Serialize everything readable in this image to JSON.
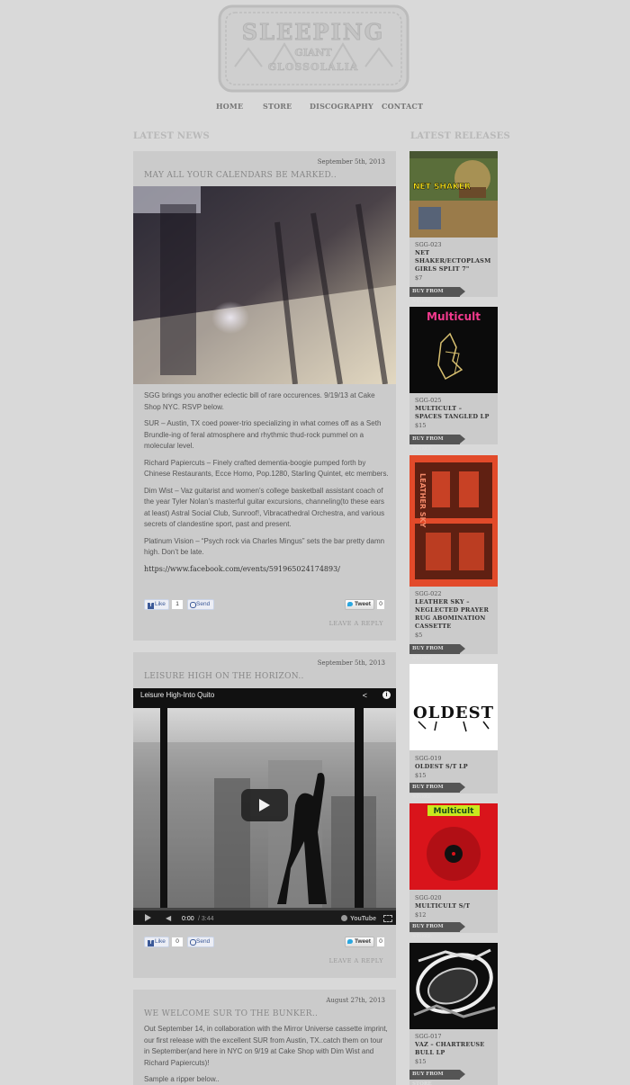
{
  "logo": {
    "line1": "SLEEPING",
    "line2": "GIANT",
    "line3": "GLOSSOLALIA"
  },
  "nav": [
    "HOME",
    "STORE",
    "DISCOGRAPHY",
    "CONTACT"
  ],
  "sections": {
    "news": "LATEST NEWS",
    "releases": "LATEST RELEASES"
  },
  "posts": [
    {
      "date": "September 5th, 2013",
      "title": "MAY ALL YOUR CALENDARS BE MARKED..",
      "paragraphs": [
        "SGG brings you another eclectic bill of rare occurences. 9/19/13 at Cake Shop NYC. RSVP below.",
        "SUR – Austin, TX coed power-trio specializing in what comes off as a Seth Brundle-ing of feral atmosphere and rhythmic thud-rock pummel on a molecular level.",
        "Richard Papiercuts – Finely crafted dementia-boogie pumped forth by Chinese Restaurants, Ecce Homo, Pop.1280, Starling Quintet, etc members.",
        "Dim Wist – Vaz guitarist and women’s college basketball assistant coach of the year Tyler Nolan’s masterful guitar excursions, channeling(to these ears at least) Astral Social Club, Sunroof!, Vibracathedral Orchestra, and various secrets of clandestine sport, past and present.",
        "Platinum Vision – “Psych rock via Charles Mingus” sets the bar pretty damn high. Don’t be late."
      ],
      "link": "https://www.facebook.com/events/591965024174893/",
      "like_label": "Like",
      "like_count": "1",
      "send_label": "Send",
      "tweet_label": "Tweet",
      "tweet_count": "0",
      "reply": "LEAVE A REPLY"
    },
    {
      "date": "September 5th, 2013",
      "title": "LEISURE HIGH ON THE HORIZON..",
      "video_title": "Leisure High-Into Quito",
      "video_time": "0:00",
      "video_duration": "/ 3:44",
      "youtube": "YouTube",
      "like_label": "Like",
      "like_count": "0",
      "send_label": "Send",
      "tweet_label": "Tweet",
      "tweet_count": "0",
      "reply": "LEAVE A REPLY"
    },
    {
      "date": "August 27th, 2013",
      "title": "WE WELCOME SUR TO THE BUNKER..",
      "paragraphs": [
        "Out September 14, in collaboration with the Mirror Universe cassette imprint, our first release with the excellent SUR from Austin, TX..catch them on tour in September(and here in NYC on 9/19 at Cake Shop with Dim Wist and Richard Papiercuts)!",
        "Sample a ripper below.."
      ]
    }
  ],
  "releases": [
    {
      "cat": "SGG-023",
      "title": "NET SHAKER/ECTOPLASM GIRLS SPLIT 7\"",
      "price": "$7",
      "buy": "BUY FROM STORE",
      "cover_text": "NET SHAKER"
    },
    {
      "cat": "SGG-025",
      "title": "MULTICULT – SPACES TANGLED LP",
      "price": "$15",
      "buy": "BUY FROM STORE",
      "cover_text": "Multicult"
    },
    {
      "cat": "SGG-022",
      "title": "LEATHER SKY – NEGLECTED PRAYER RUG ABOMINATION CASSETTE",
      "price": "$5",
      "buy": "BUY FROM STORE",
      "cover_text": "LEATHER SKY"
    },
    {
      "cat": "SGG-019",
      "title": "OLDEST S/T LP",
      "price": "$15",
      "buy": "BUY FROM STORE",
      "cover_text": "OLDEST"
    },
    {
      "cat": "SGG-020",
      "title": "MULTICULT S/T",
      "price": "$12",
      "buy": "BUY FROM STORE",
      "cover_text": "Multicult"
    },
    {
      "cat": "SGG-017",
      "title": "VAZ – CHARTREUSE BULL LP",
      "price": "$15",
      "buy": "BUY FROM STORE",
      "cover_text": ""
    }
  ]
}
